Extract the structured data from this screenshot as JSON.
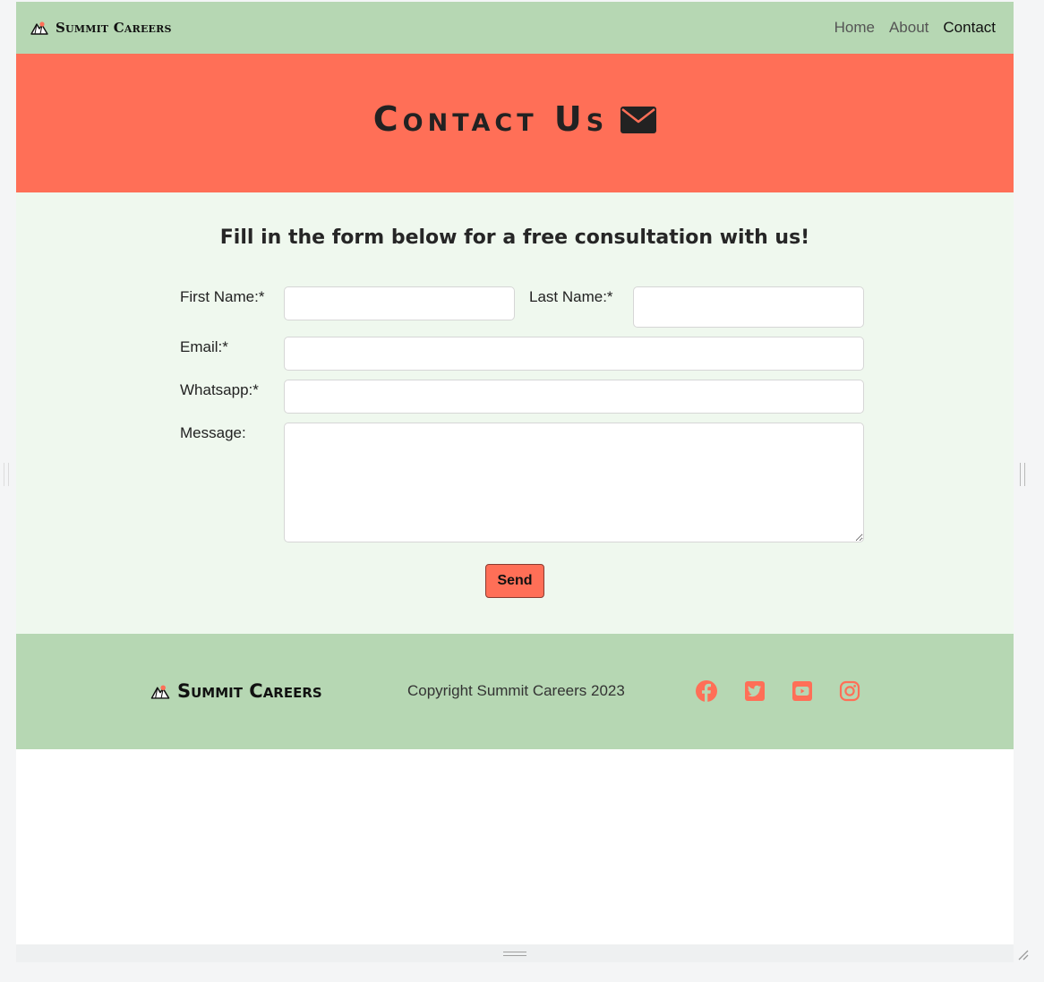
{
  "navbar": {
    "brand": "Summit Careers",
    "links": [
      {
        "label": "Home",
        "active": false
      },
      {
        "label": "About",
        "active": false
      },
      {
        "label": "Contact",
        "active": true
      }
    ]
  },
  "hero": {
    "title": "Contact Us",
    "icon": "envelope-icon"
  },
  "form": {
    "heading": "Fill in the form below for a free consultation with us!",
    "fields": {
      "first_name": {
        "label": "First Name:*",
        "value": ""
      },
      "last_name": {
        "label": "Last Name:*",
        "value": ""
      },
      "email": {
        "label": "Email:*",
        "value": ""
      },
      "whatsapp": {
        "label": "Whatsapp:*",
        "value": ""
      },
      "message": {
        "label": "Message:",
        "value": ""
      }
    },
    "submit_label": "Send"
  },
  "footer": {
    "brand": "Summit Careers",
    "copyright": "Copyright Summit Careers 2023",
    "social": [
      "facebook-icon",
      "twitter-icon",
      "youtube-icon",
      "instagram-icon"
    ]
  },
  "colors": {
    "nav_green": "#b6d7b3",
    "hero_coral": "#ff6f57",
    "form_bg": "#eff8ee",
    "accent": "#ff6f57"
  }
}
